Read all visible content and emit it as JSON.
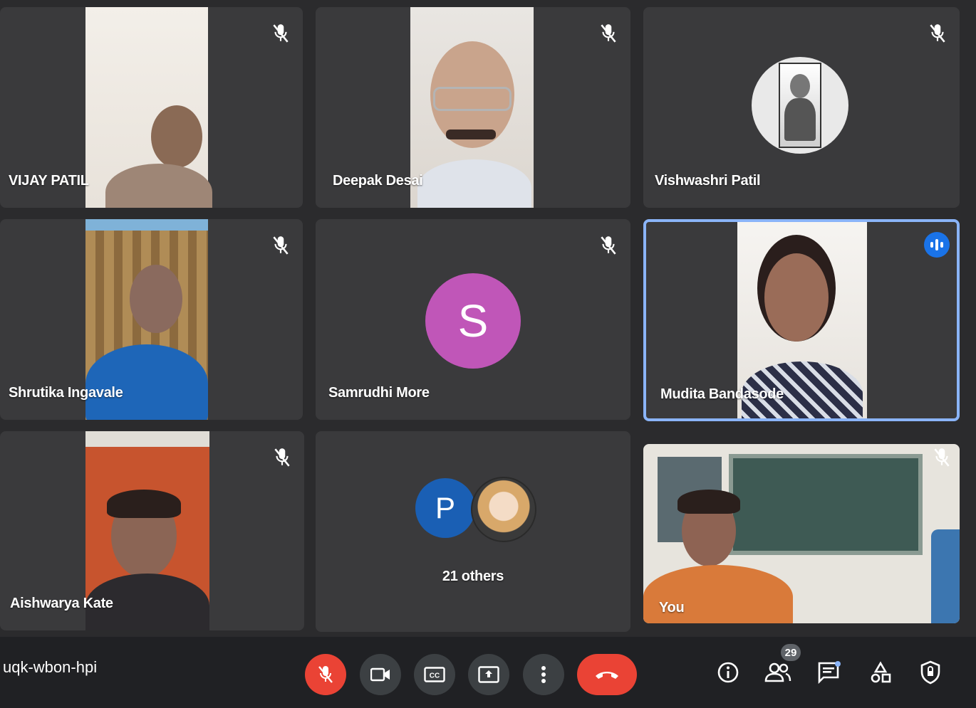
{
  "participants": [
    {
      "name": "VIJAY PATIL",
      "muted": true
    },
    {
      "name": "Deepak Desai",
      "muted": true
    },
    {
      "name": "Vishwashri Patil",
      "muted": true
    },
    {
      "name": "Shrutika Ingavale",
      "muted": true
    },
    {
      "name": "Samrudhi More",
      "muted": true,
      "initial": "S",
      "avatar_color": "#c056b8"
    },
    {
      "name": "Mudita Bandasode",
      "muted": false,
      "speaking": true
    },
    {
      "name": "Aishwarya Kate",
      "muted": true
    },
    {
      "name": "21 others",
      "initial": "P",
      "avatar_color": "#1a5fb4"
    },
    {
      "name": "You",
      "muted": true
    }
  ],
  "toolbar": {
    "meeting_code": "uqk-wbon-hpi",
    "participant_count": "29",
    "accent_red": "#ea4335",
    "buttons": [
      "mic-off-icon",
      "camera-icon",
      "captions-icon",
      "present-icon",
      "more-icon",
      "hangup-icon"
    ],
    "side_icons": [
      "info-icon",
      "people-icon",
      "chat-icon",
      "activities-icon",
      "host-controls-icon"
    ]
  }
}
